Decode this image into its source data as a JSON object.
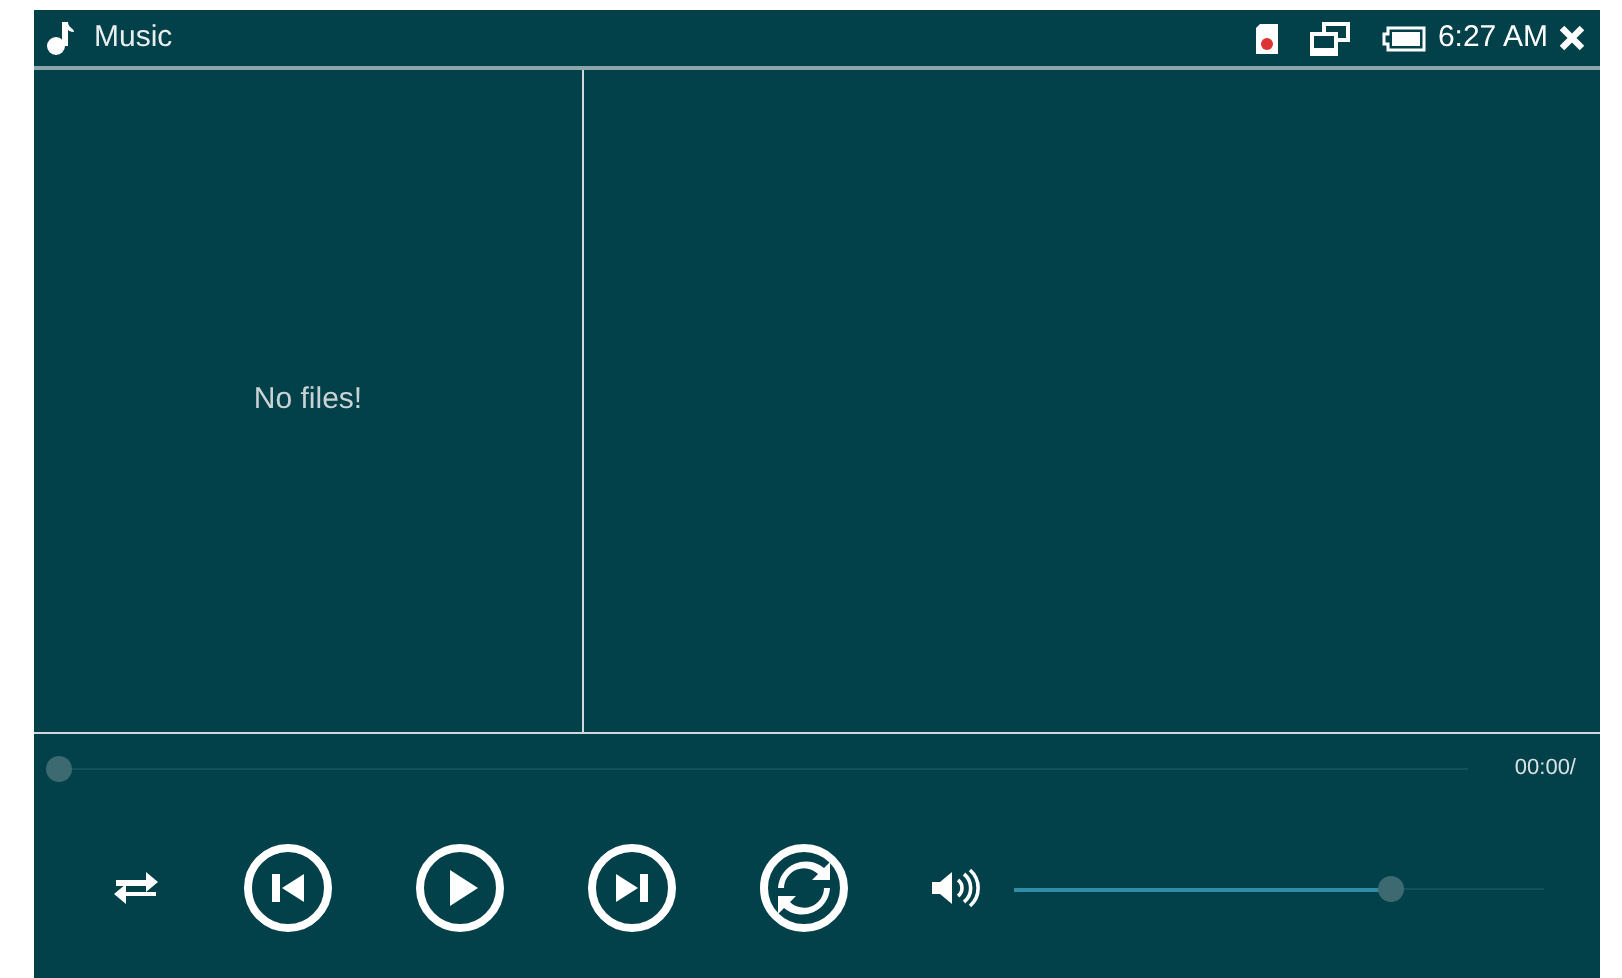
{
  "window": {
    "title": "Music",
    "time": "6:27 AM"
  },
  "file_list": {
    "empty_text": "No files!"
  },
  "progress": {
    "level": 0,
    "time": "00:00/"
  },
  "controls": [
    {
      "kind": "repeat"
    },
    {
      "kind": "previous"
    },
    {
      "kind": "play"
    },
    {
      "kind": "next"
    },
    {
      "kind": "shuffle"
    }
  ],
  "volume": {
    "level": 0.71
  }
}
